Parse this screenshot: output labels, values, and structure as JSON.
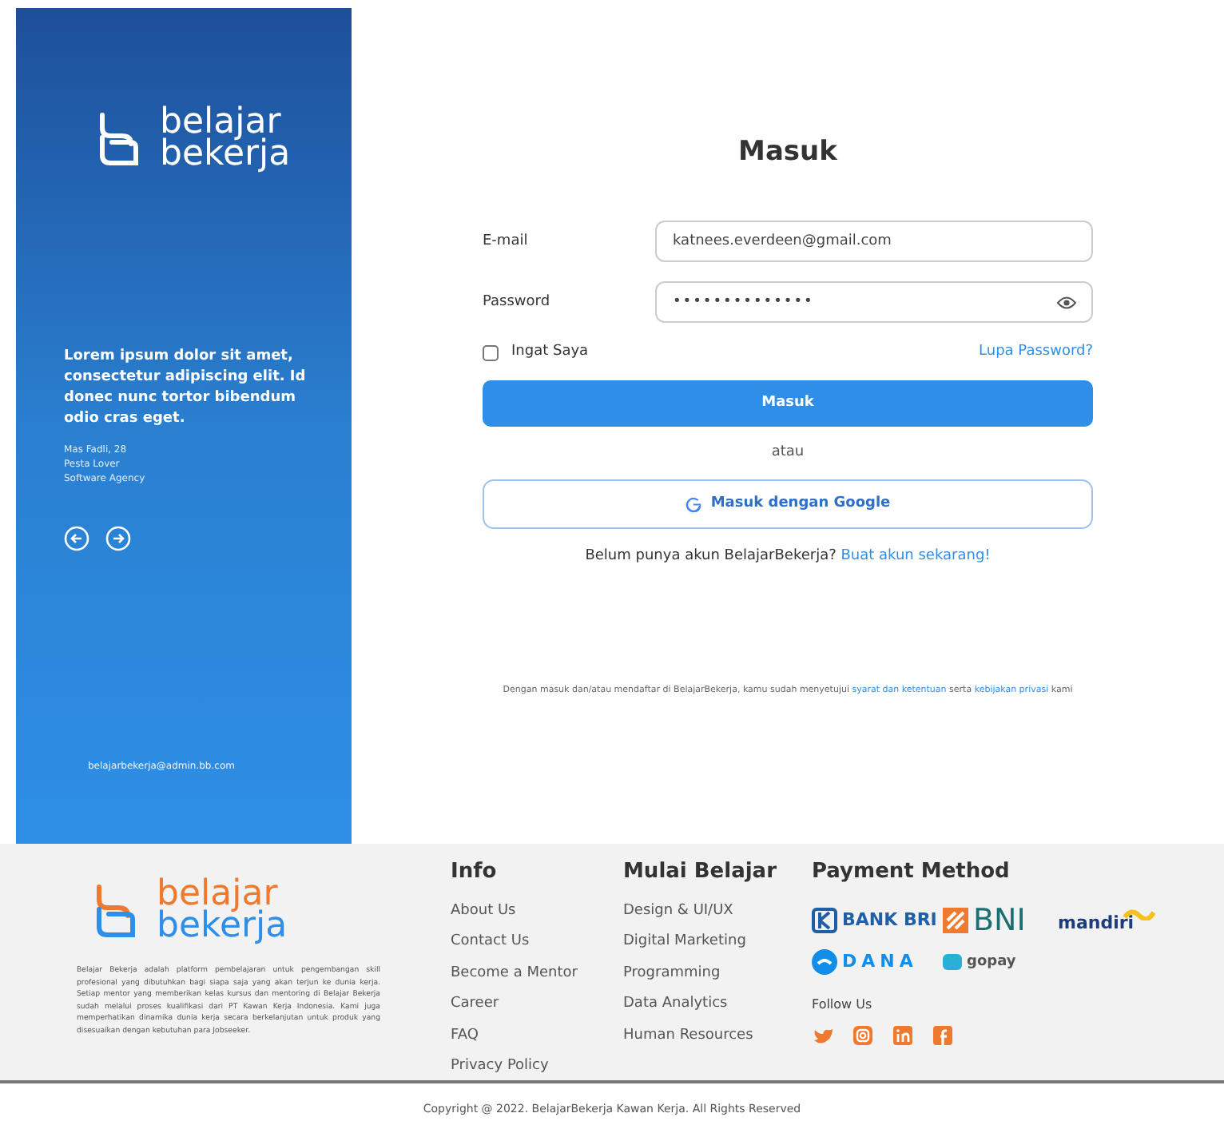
{
  "side_panel": {
    "logo": [
      "belajar",
      "bekerja"
    ],
    "quote": "Lorem ipsum dolor sit amet, consectetur adipiscing elit. Id donec nunc tortor bibendum odio cras eget.",
    "author": [
      "Mas Fadli, 28",
      "Pesta Lover",
      "Software Agency"
    ],
    "email": "belajarbekerja@admin.bb.com"
  },
  "login": {
    "title": "Masuk",
    "fields": [
      {
        "label": "E-mail",
        "value": "katnees.everdeen@gmail.com",
        "kind": "text"
      },
      {
        "label": "Password",
        "value": "••••••••••••••",
        "kind": "password"
      }
    ],
    "remember": {
      "label": "Ingat Saya",
      "checked": false
    },
    "forgot": "Lupa Password?",
    "submit": "Masuk",
    "or": "atau",
    "google": "Masuk dengan Google",
    "signup_text": "Belum punya akun BelajarBekerja?",
    "signup_link": "Buat akun sekarang!",
    "terms": [
      "Dengan masuk dan/atau mendaftar di BelajarBekerja, kamu sudah menyetujui ",
      "syarat dan ketentuan",
      " serta ",
      "kebijakan privasi",
      " kami"
    ]
  },
  "footer": {
    "logo": [
      "belajar",
      "bekerja"
    ],
    "about": "Belajar Bekerja adalah platform pembelajaran untuk pengembangan skill profesional yang dibutuhkan bagi siapa saja yang akan terjun ke dunia kerja. Setiap mentor yang memberikan kelas kursus dan mentoring di Belajar Bekerja sudah melalui proses kualifikasi dari PT Kawan Kerja Indonesia. Kami juga memperhatikan dinamika dunia kerja secara berkelanjutan untuk produk yang disesuaikan dengan kebutuhan para Jobseeker.",
    "columns": [
      {
        "title": "Info",
        "links": [
          "About Us",
          "Contact Us",
          "Become a Mentor",
          "Career",
          "FAQ",
          "Privacy Policy"
        ]
      },
      {
        "title": "Mulai Belajar",
        "links": [
          "Design & UI/UX",
          "Digital Marketing",
          "Programming",
          "Data Analytics",
          "Human Resources"
        ]
      }
    ],
    "payment_title": "Payment Method",
    "payments": [
      {
        "kind": "bri",
        "name": "BANK BRI"
      },
      {
        "kind": "bni",
        "name": "BNI"
      },
      {
        "kind": "mandiri",
        "name": "mandiri"
      },
      {
        "kind": "dana",
        "name": "DANA"
      },
      {
        "kind": "gopay",
        "name": "gopay"
      }
    ],
    "follow_title": "Follow Us",
    "socials": [
      {
        "kind": "twitter"
      },
      {
        "kind": "instagram"
      },
      {
        "kind": "linkedin"
      },
      {
        "kind": "facebook"
      }
    ],
    "copyright": "Copyright @ 2022. BelajarBekerja Kawan Kerja. All Rights Reserved"
  }
}
